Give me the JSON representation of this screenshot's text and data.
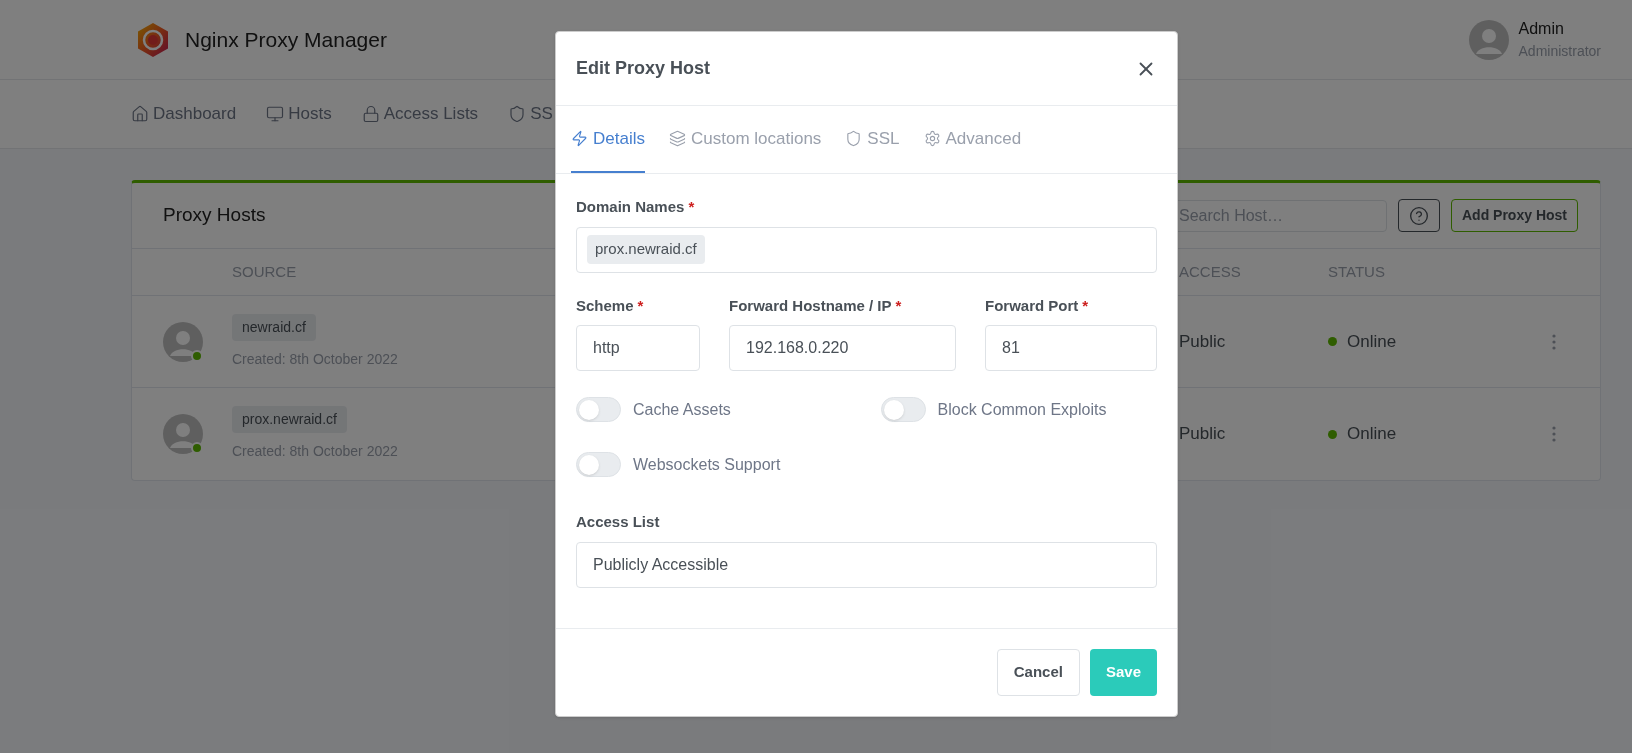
{
  "header": {
    "app_title": "Nginx Proxy Manager",
    "user": {
      "name": "Admin",
      "role": "Administrator"
    }
  },
  "nav": [
    {
      "label": "Dashboard"
    },
    {
      "label": "Hosts"
    },
    {
      "label": "Access Lists"
    },
    {
      "label": "SS"
    }
  ],
  "card": {
    "title": "Proxy Hosts",
    "search": {
      "placeholder": "Search Host…"
    },
    "add_button": "Add Proxy Host",
    "table": {
      "columns": [
        "SOURCE",
        "ACCESS",
        "STATUS"
      ],
      "rows": [
        {
          "domain": "newraid.cf",
          "created": "Created: 8th October 2022",
          "access": "Public",
          "status": "Online",
          "online": true
        },
        {
          "domain": "prox.newraid.cf",
          "created": "Created: 8th October 2022",
          "access": "Public",
          "status": "Online",
          "online": true
        }
      ]
    }
  },
  "modal": {
    "title": "Edit Proxy Host",
    "tabs": [
      {
        "label": "Details",
        "selected": true
      },
      {
        "label": "Custom locations",
        "selected": false
      },
      {
        "label": "SSL",
        "selected": false
      },
      {
        "label": "Advanced",
        "selected": false
      }
    ],
    "domain_names": {
      "label": "Domain Names",
      "required_mark": "*",
      "tags": [
        "prox.newraid.cf"
      ]
    },
    "scheme": {
      "label": "Scheme",
      "required_mark": "*",
      "value": "http"
    },
    "forward_host": {
      "label": "Forward Hostname / IP",
      "required_mark": "*",
      "value": "192.168.0.220"
    },
    "forward_port": {
      "label": "Forward Port",
      "required_mark": "*",
      "value": "81"
    },
    "toggles": [
      {
        "label": "Cache Assets",
        "on": false
      },
      {
        "label": "Block Common Exploits",
        "on": false
      },
      {
        "label": "Websockets Support",
        "on": false
      }
    ],
    "access_list": {
      "label": "Access List",
      "value": "Publicly Accessible"
    },
    "buttons": [
      {
        "label": "Cancel",
        "kind": "secondary"
      },
      {
        "label": "Save",
        "kind": "primary"
      }
    ]
  }
}
